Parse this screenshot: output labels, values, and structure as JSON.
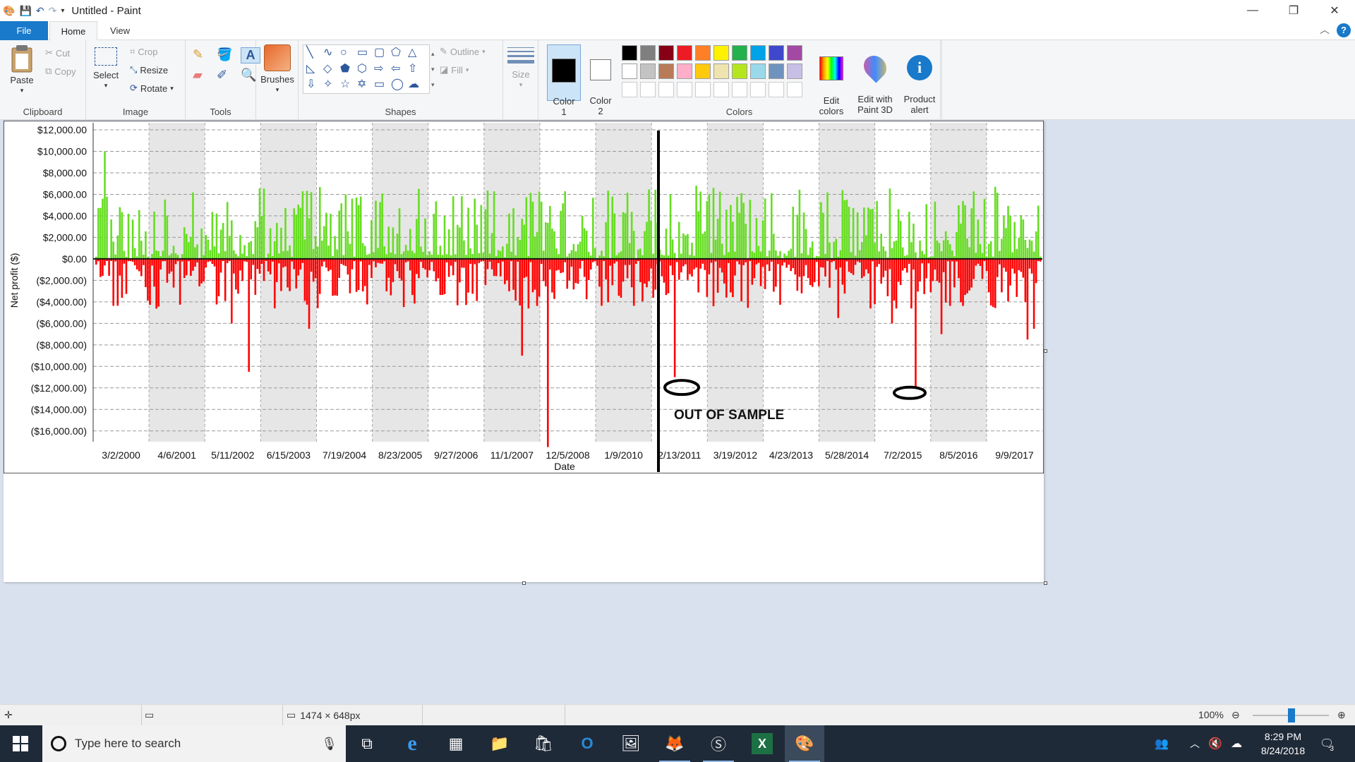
{
  "app": {
    "title": "Untitled - Paint"
  },
  "tabs": {
    "file": "File",
    "home": "Home",
    "view": "View"
  },
  "ribbon": {
    "clipboard": {
      "label": "Clipboard",
      "paste": "Paste",
      "cut": "Cut",
      "copy": "Copy"
    },
    "image": {
      "label": "Image",
      "select": "Select",
      "crop": "Crop",
      "resize": "Resize",
      "rotate": "Rotate"
    },
    "tools": {
      "label": "Tools"
    },
    "brushes": {
      "label": "Brushes"
    },
    "shapes": {
      "label": "Shapes",
      "outline": "Outline",
      "fill": "Fill"
    },
    "size": {
      "label": "Size"
    },
    "colors": {
      "label": "Colors",
      "color1": "Color\n1",
      "color2": "Color\n2",
      "edit_colors": "Edit\ncolors"
    },
    "paint3d": {
      "label": "Edit with\nPaint 3D"
    },
    "product_alert": {
      "label": "Product\nalert"
    },
    "palette_row1": [
      "#000000",
      "#7f7f7f",
      "#880015",
      "#ed1c24",
      "#ff7f27",
      "#fff200",
      "#22b14c",
      "#00a2e8",
      "#3f48cc",
      "#a349a4"
    ],
    "palette_row2": [
      "#ffffff",
      "#c3c3c3",
      "#b97a57",
      "#ffaec9",
      "#ffc90e",
      "#efe4b0",
      "#b5e61d",
      "#99d9ea",
      "#7092be",
      "#c8bfe7"
    ]
  },
  "status": {
    "dimensions": "1474 × 648px",
    "zoom": "100%"
  },
  "taskbar": {
    "search_placeholder": "Type here to search",
    "time": "8:29 PM",
    "date": "8/24/2018",
    "notification_count": "3"
  },
  "chart_data": {
    "type": "bar",
    "ylabel": "Net profit ($)",
    "xlabel": "Date",
    "ylim": [
      -17000,
      12000
    ],
    "yticks": [
      "$12,000.00",
      "$10,000.00",
      "$8,000.00",
      "$6,000.00",
      "$4,000.00",
      "$2,000.00",
      "$0.00",
      "($2,000.00)",
      "($4,000.00)",
      "($6,000.00)",
      "($8,000.00)",
      "($10,000.00)",
      "($12,000.00)",
      "($14,000.00)",
      "($16,000.00)"
    ],
    "xticks": [
      "3/2/2000",
      "4/6/2001",
      "5/11/2002",
      "6/15/2003",
      "7/19/2004",
      "8/23/2005",
      "9/27/2006",
      "11/1/2007",
      "12/5/2008",
      "1/9/2010",
      "2/13/2011",
      "3/19/2012",
      "4/23/2013",
      "5/28/2014",
      "7/2/2015",
      "8/5/2016",
      "9/9/2017"
    ],
    "annotation": "OUT OF SAMPLE",
    "positive_color": "#66dd22",
    "negative_color": "#ff0000",
    "notable_values": {
      "max_gain": 12000,
      "max_loss": -17500,
      "loss_2011": -11500,
      "loss_2015": -12000
    }
  }
}
